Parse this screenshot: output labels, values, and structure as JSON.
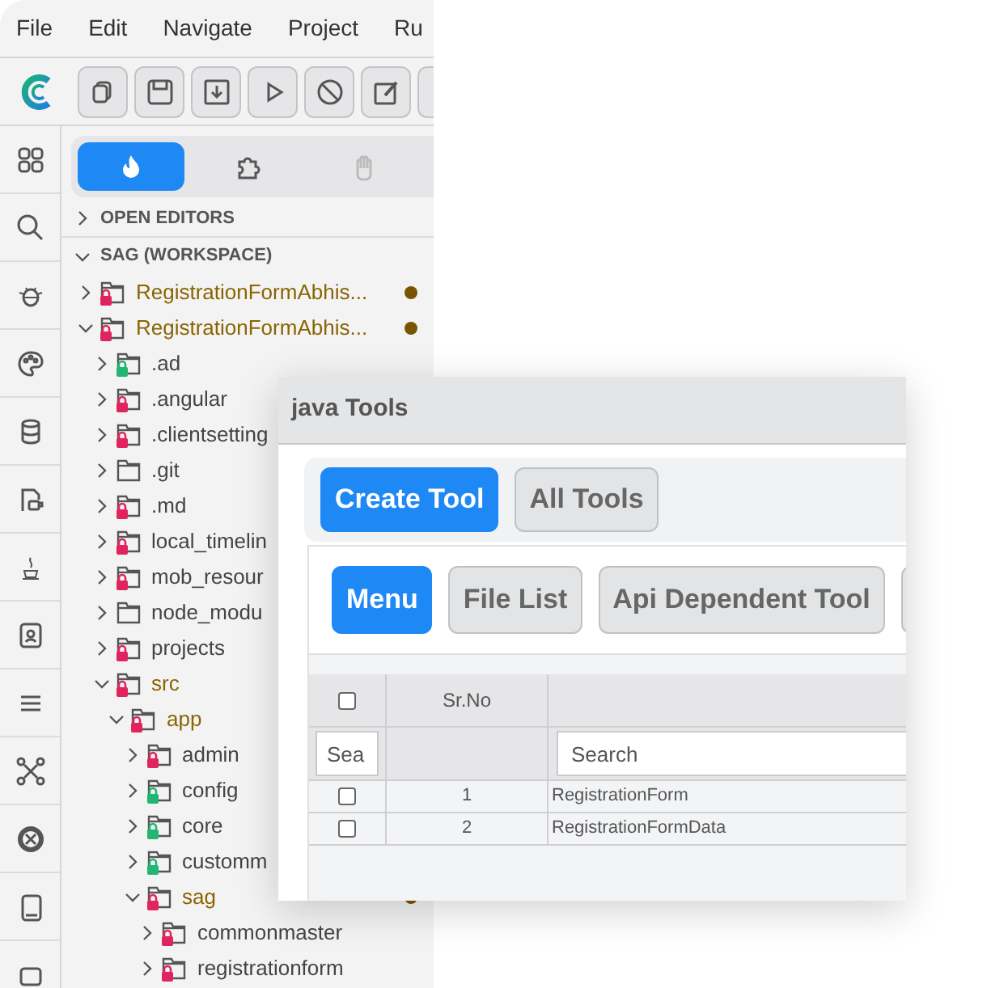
{
  "menu": [
    "File",
    "Edit",
    "Navigate",
    "Project",
    "Ru"
  ],
  "sidebar_tabs": [
    {
      "selected": true
    },
    {
      "selected": false
    },
    {
      "selected": false
    }
  ],
  "sections": [
    {
      "label": "OPEN EDITORS",
      "expanded": false
    },
    {
      "label": "SAG (WORKSPACE)",
      "expanded": true
    }
  ],
  "tree": [
    {
      "label": "RegistrationFormAbhis...",
      "expanded": false,
      "color": "#e0245e",
      "modified": true,
      "dot": true
    },
    {
      "label": "RegistrationFormAbhis...",
      "expanded": true,
      "color": "#e0245e",
      "modified": true,
      "dot": true,
      "children": [
        {
          "label": ".ad",
          "expanded": false,
          "color": "#22b573"
        },
        {
          "label": ".angular",
          "expanded": false,
          "color": "#e0245e"
        },
        {
          "label": ".clientsetting",
          "expanded": false,
          "color": "#e0245e"
        },
        {
          "label": ".git",
          "expanded": false
        },
        {
          "label": ".md",
          "expanded": false,
          "color": "#e0245e"
        },
        {
          "label": "local_timelin",
          "expanded": false,
          "color": "#e0245e"
        },
        {
          "label": "mob_resour",
          "expanded": false,
          "color": "#e0245e"
        },
        {
          "label": "node_modu",
          "expanded": false
        },
        {
          "label": "projects",
          "expanded": false,
          "color": "#e0245e"
        },
        {
          "label": "src",
          "expanded": true,
          "color": "#e0245e",
          "modified": true,
          "children": [
            {
              "label": "app",
              "expanded": true,
              "color": "#e0245e",
              "modified": true,
              "children": [
                {
                  "label": "admin",
                  "expanded": false,
                  "color": "#e0245e"
                },
                {
                  "label": "config",
                  "expanded": false,
                  "color": "#22b573"
                },
                {
                  "label": "core",
                  "expanded": false,
                  "color": "#22b573"
                },
                {
                  "label": "customm",
                  "expanded": false,
                  "color": "#22b573"
                },
                {
                  "label": "sag",
                  "expanded": true,
                  "color": "#e0245e",
                  "modified": true,
                  "dot": true,
                  "children": [
                    {
                      "label": "commonmaster",
                      "expanded": false,
                      "color": "#e0245e"
                    },
                    {
                      "label": "registrationform",
                      "expanded": false,
                      "color": "#e0245e"
                    }
                  ]
                }
              ]
            }
          ]
        }
      ]
    }
  ],
  "window": {
    "title": "java Tools",
    "top_buttons": [
      {
        "label": "Create Tool",
        "selected": true
      },
      {
        "label": "All Tools",
        "selected": false
      }
    ],
    "tabs": [
      {
        "label": "Menu",
        "selected": true
      },
      {
        "label": "File List",
        "selected": false
      },
      {
        "label": "Api Dependent Tool",
        "selected": false
      }
    ],
    "table": {
      "header_checked": false,
      "columns": [
        "Sr.No"
      ],
      "filters": [
        {
          "placeholder": "Sea"
        },
        {
          "placeholder": "Search"
        }
      ],
      "rows": [
        {
          "checked": false,
          "sr_no": "1",
          "name": "RegistrationForm"
        },
        {
          "checked": false,
          "sr_no": "2",
          "name": "RegistrationFormData"
        }
      ]
    }
  }
}
